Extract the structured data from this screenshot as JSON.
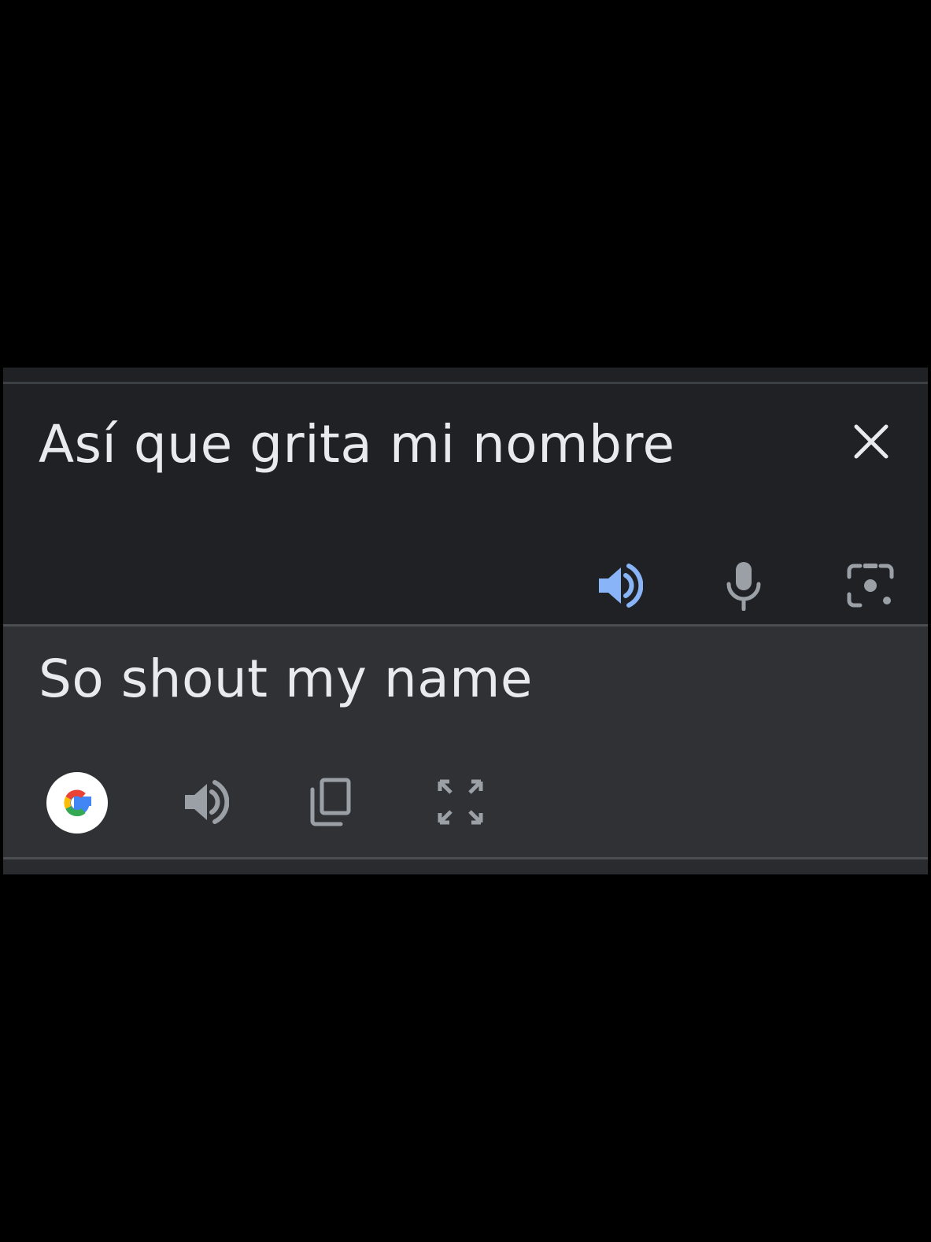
{
  "source": {
    "text": "Así que grita mi nombre",
    "icons": [
      "close-icon",
      "volume-icon",
      "mic-icon",
      "camera-lens-icon"
    ],
    "speaker_accent": "#8ab4f8"
  },
  "target": {
    "text": "So shout my name",
    "icons": [
      "google-icon",
      "volume-icon",
      "copy-icon",
      "fullscreen-icon"
    ]
  },
  "colors": {
    "background": "#000000",
    "source_panel": "#202124",
    "target_panel": "#303134",
    "text": "#e8eaed",
    "icon_gray": "#9aa0a6"
  }
}
